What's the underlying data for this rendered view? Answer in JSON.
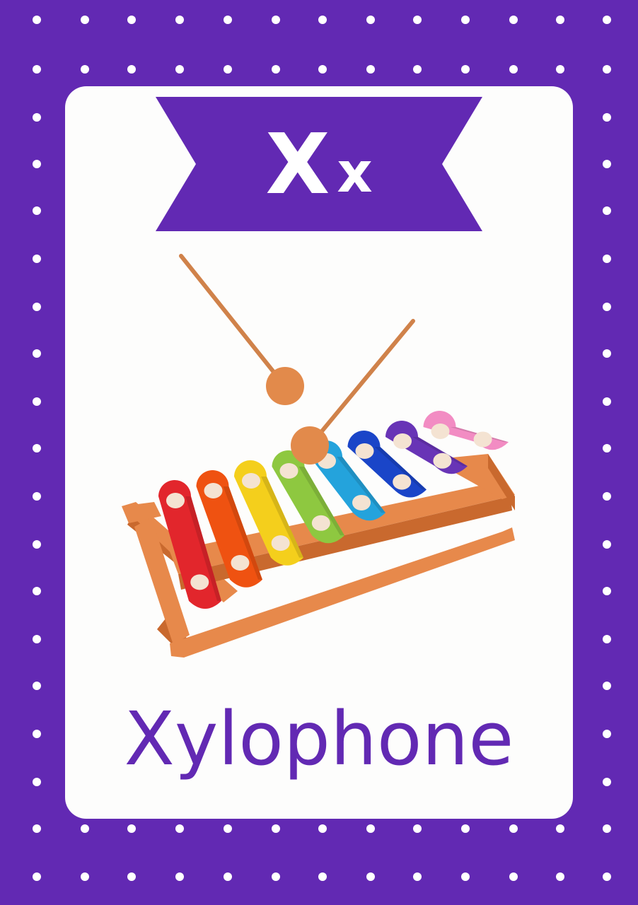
{
  "card": {
    "letter_upper": "X",
    "letter_lower": "x",
    "word": "Xylophone"
  },
  "colors": {
    "frame": "#6229b3",
    "card": "#fdfdfc",
    "banner": "#6229b3",
    "mallet": "#d0824a",
    "mallet_head": "#e28a4b",
    "frame_wood": "#e7894b",
    "bars": [
      "#e2262c",
      "#ef5211",
      "#f4cf1c",
      "#8ec840",
      "#24a3dc",
      "#1a45c8",
      "#6834b6",
      "#f28cc3"
    ],
    "bar_dot": "#f4e3d2"
  },
  "icons": {
    "illustration": "xylophone-with-mallets"
  }
}
